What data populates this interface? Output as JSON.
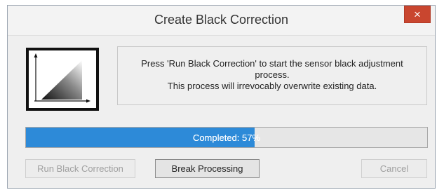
{
  "window": {
    "title": "Create Black Correction",
    "close_label": "×"
  },
  "icon": {
    "name": "black-correction-ramp-icon"
  },
  "message": {
    "line1": "Press 'Run Black Correction' to start the sensor black adjustment",
    "line2": "process.",
    "line3": "This process will irrevocably overwrite existing data."
  },
  "progress": {
    "label": "Completed: 57%",
    "percent": 57,
    "fill_color": "#2d8ad8"
  },
  "buttons": {
    "run_label": "Run Black Correction",
    "break_label": "Break Processing",
    "cancel_label": "Cancel"
  },
  "colors": {
    "close_button": "#c9462f"
  }
}
